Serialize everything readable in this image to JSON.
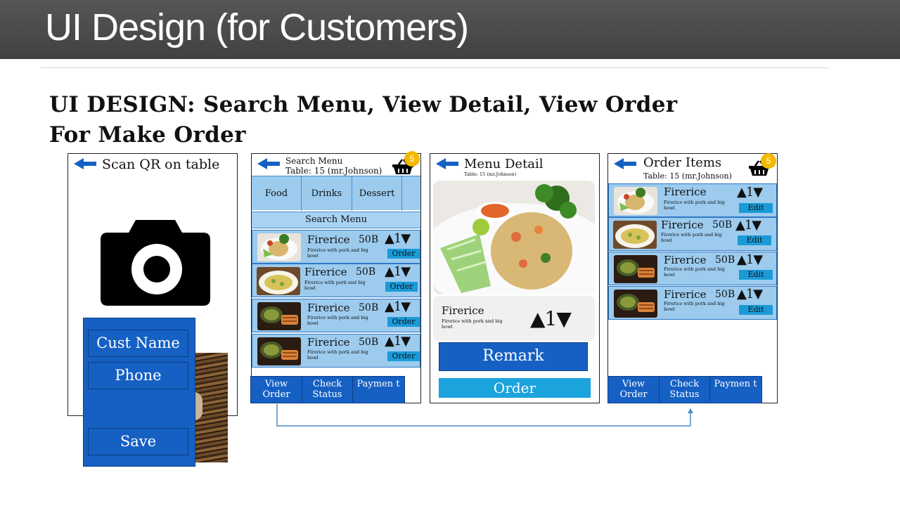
{
  "slide": {
    "title": "UI Design (for Customers)",
    "heading_line1": "UI DESIGN: Search Menu, View Detail, View Order",
    "heading_line2": "For Make Order"
  },
  "screen1": {
    "title": "Scan QR on table",
    "fields": [
      "Cust Name",
      "Phone"
    ],
    "save_label": "Save"
  },
  "screen2": {
    "title": "Search Menu",
    "table": "Table: 15 (mr.Johnson)",
    "cart_count": "5",
    "categories": [
      "Food",
      "Drinks",
      "Dessert"
    ],
    "search_label": "Search Menu",
    "items": [
      {
        "name": "Firerice",
        "price": "50B",
        "desc": "Firerice with pork and big bowl",
        "qty": "1",
        "button": "Order"
      },
      {
        "name": "Firerice",
        "price": "50B",
        "desc": "Firerice with pork and big bowl",
        "qty": "1",
        "button": "Order"
      },
      {
        "name": "Firerice",
        "price": "50B",
        "desc": "Firerice with pork and big bowl",
        "qty": "1",
        "button": "Order"
      },
      {
        "name": "Firerice",
        "price": "50B",
        "desc": "Firerice with pork and big bowl",
        "qty": "1",
        "button": "Order"
      }
    ],
    "nav": [
      "View Order",
      "Check Status",
      "Paymen t"
    ]
  },
  "screen3": {
    "title": "Menu Detail",
    "table": "Table: 15 (mr.Johnson)",
    "item_name": "Firerice",
    "item_desc": "Firerice with pork and big bowl",
    "qty": "1",
    "remark_label": "Remark",
    "order_label": "Order"
  },
  "screen4": {
    "title": "Order Items",
    "table": "Table: 15 (mr.Johnson)",
    "cart_count": "5",
    "items": [
      {
        "name": "Firerice",
        "price": "",
        "desc": "Firerice with pork and big bowl",
        "qty": "1",
        "button": "Edit"
      },
      {
        "name": "Firerice",
        "price": "50B",
        "desc": "Firerice with pork and big bowl",
        "qty": "1",
        "button": "Edit"
      },
      {
        "name": "Firerice",
        "price": "50B",
        "desc": "Firerice with pork and big bowl",
        "qty": "1",
        "button": "Edit"
      },
      {
        "name": "Firerice",
        "price": "50B",
        "desc": "Firerice with pork and big bowl",
        "qty": "1",
        "button": "Edit"
      }
    ],
    "nav": [
      "View Order",
      "Check Status",
      "Paymen t"
    ]
  },
  "colors": {
    "primary_blue": "#1660c4",
    "light_blue": "#9ccbee",
    "accent_cyan": "#1ba3dd",
    "badge": "#f5b800",
    "banner": "#4a4a4a"
  }
}
